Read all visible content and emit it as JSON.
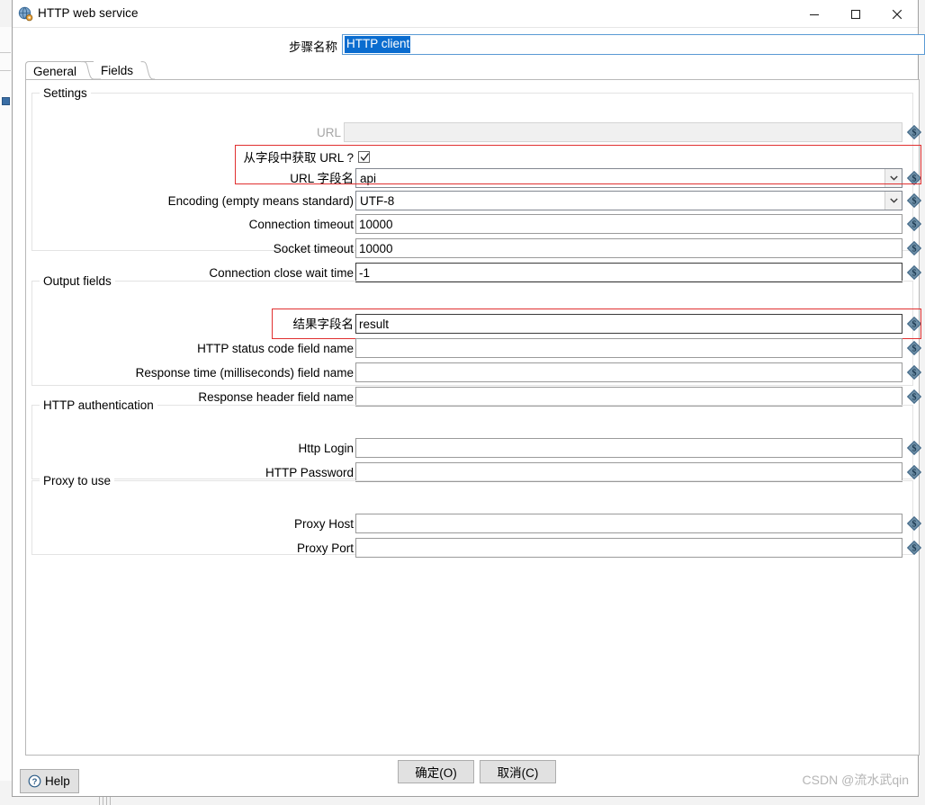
{
  "window": {
    "title": "HTTP web service",
    "icon": "globe-gear-icon",
    "controls": {
      "minimize": "minimize-icon",
      "maximize": "maximize-icon",
      "close": "close-icon"
    }
  },
  "stepname": {
    "label": "步骤名称",
    "value": "HTTP client"
  },
  "tabs": [
    {
      "label": "General",
      "selected": true
    },
    {
      "label": "Fields",
      "selected": false
    }
  ],
  "groups": {
    "settings": {
      "title": "Settings",
      "rows": [
        {
          "label": "URL",
          "value": "",
          "type": "text",
          "disabled": true
        },
        {
          "label": "从字段中获取 URL ?",
          "value": "checked",
          "type": "checkbox"
        },
        {
          "label": "URL 字段名",
          "value": "api",
          "type": "combo"
        },
        {
          "label": "Encoding (empty means standard)",
          "value": "UTF-8",
          "type": "combo"
        },
        {
          "label": "Connection timeout",
          "value": "10000",
          "type": "text"
        },
        {
          "label": "Socket timeout",
          "value": "10000",
          "type": "text"
        },
        {
          "label": "Connection close wait time",
          "value": "-1",
          "type": "text"
        }
      ]
    },
    "output": {
      "title": "Output fields",
      "rows": [
        {
          "label": "结果字段名",
          "value": "result",
          "type": "text"
        },
        {
          "label": "HTTP status code field name",
          "value": "",
          "type": "text"
        },
        {
          "label": "Response time (milliseconds) field name",
          "value": "",
          "type": "text"
        },
        {
          "label": "Response header field name",
          "value": "",
          "type": "text"
        }
      ]
    },
    "auth": {
      "title": "HTTP authentication",
      "rows": [
        {
          "label": "Http Login",
          "value": "",
          "type": "text"
        },
        {
          "label": "HTTP Password",
          "value": "",
          "type": "text"
        }
      ]
    },
    "proxy": {
      "title": "Proxy to use",
      "rows": [
        {
          "label": "Proxy Host",
          "value": "",
          "type": "text"
        },
        {
          "label": "Proxy Port",
          "value": "",
          "type": "text"
        }
      ]
    }
  },
  "buttons": {
    "ok": "确定(O)",
    "cancel": "取消(C)",
    "help": "Help"
  },
  "watermark": "CSDN @流水武qin",
  "colors": {
    "selection": "#0a6ccf",
    "annotation": "#e03030",
    "variable_icon": "#3d6484",
    "focus_border": "#5a9ad4"
  },
  "icons": {
    "variable": "dollar-diamond-icon",
    "dropdown": "chevron-down-icon",
    "help": "question-circle-icon",
    "checkbox_check": "check-icon"
  }
}
